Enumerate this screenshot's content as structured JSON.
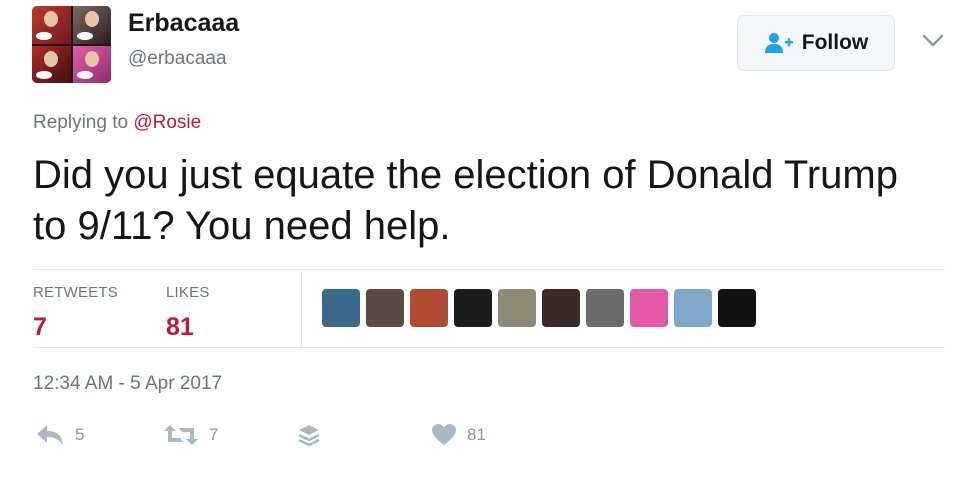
{
  "author": {
    "display_name": "Erbacaaa",
    "handle": "@erbacaaa"
  },
  "follow_button": {
    "label": "Follow",
    "icon": "add-user-icon"
  },
  "menu": {
    "icon": "chevron-down-icon"
  },
  "reply_context": {
    "prefix": "Replying to",
    "mention": "@Rosie"
  },
  "tweet": {
    "text": "Did you just equate the election of Donald Trump to 9/11? You need help."
  },
  "stats": {
    "retweets": {
      "label": "RETWEETS",
      "value": "7"
    },
    "likes": {
      "label": "LIKES",
      "value": "81"
    }
  },
  "likers_avatars": [
    {
      "color": "#3b6a8a"
    },
    {
      "color": "#5a4a44"
    },
    {
      "color": "#b24a33"
    },
    {
      "color": "#1b1b1b"
    },
    {
      "color": "#8c8a74"
    },
    {
      "color": "#3a2a24"
    },
    {
      "color": "#6b6b6b"
    },
    {
      "color": "#e25aa8"
    },
    {
      "color": "#7fa7c9"
    },
    {
      "color": "#111111"
    }
  ],
  "timestamp": "12:34 AM - 5 Apr 2017",
  "actions": {
    "reply": {
      "icon": "reply-icon",
      "count": "5"
    },
    "retweet": {
      "icon": "retweet-icon",
      "count": "7"
    },
    "stack": {
      "icon": "layers-icon"
    },
    "like": {
      "icon": "heart-icon",
      "count": "81"
    }
  },
  "colors": {
    "accent": "#c0163f",
    "secondary_text": "#657786",
    "action_icon": "#aab8c2",
    "follow_icon": "#1da1f2"
  }
}
